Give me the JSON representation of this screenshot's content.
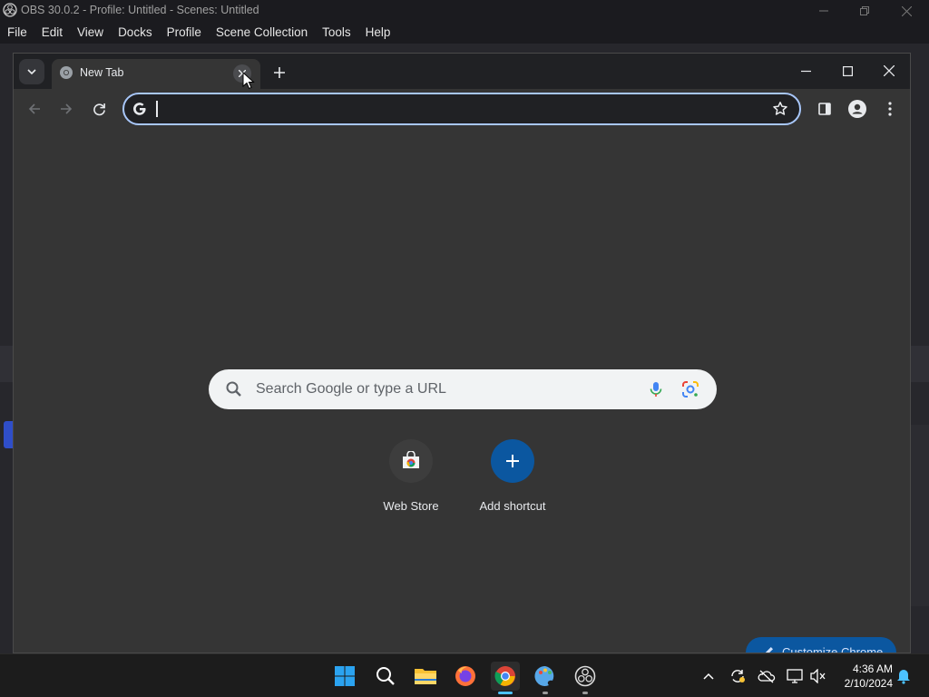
{
  "obs": {
    "title": "OBS 30.0.2 - Profile: Untitled - Scenes: Untitled",
    "menu": [
      "File",
      "Edit",
      "View",
      "Docks",
      "Profile",
      "Scene Collection",
      "Tools",
      "Help"
    ]
  },
  "chrome": {
    "tab": {
      "title": "New Tab"
    },
    "omnibox": {
      "value": "",
      "placeholder": ""
    },
    "ntp": {
      "search_placeholder": "Search Google or type a URL",
      "shortcuts": [
        {
          "label": "Web Store"
        },
        {
          "label": "Add shortcut"
        }
      ],
      "customize_label": "Customize Chrome"
    }
  },
  "taskbar": {
    "time": "4:36 AM",
    "date": "2/10/2024"
  },
  "colors": {
    "focus_ring": "#a8c7fa",
    "customize_button": "#0b57a0",
    "add_shortcut": "#0b57a0",
    "taskbar_accent": "#4cc2ff"
  }
}
